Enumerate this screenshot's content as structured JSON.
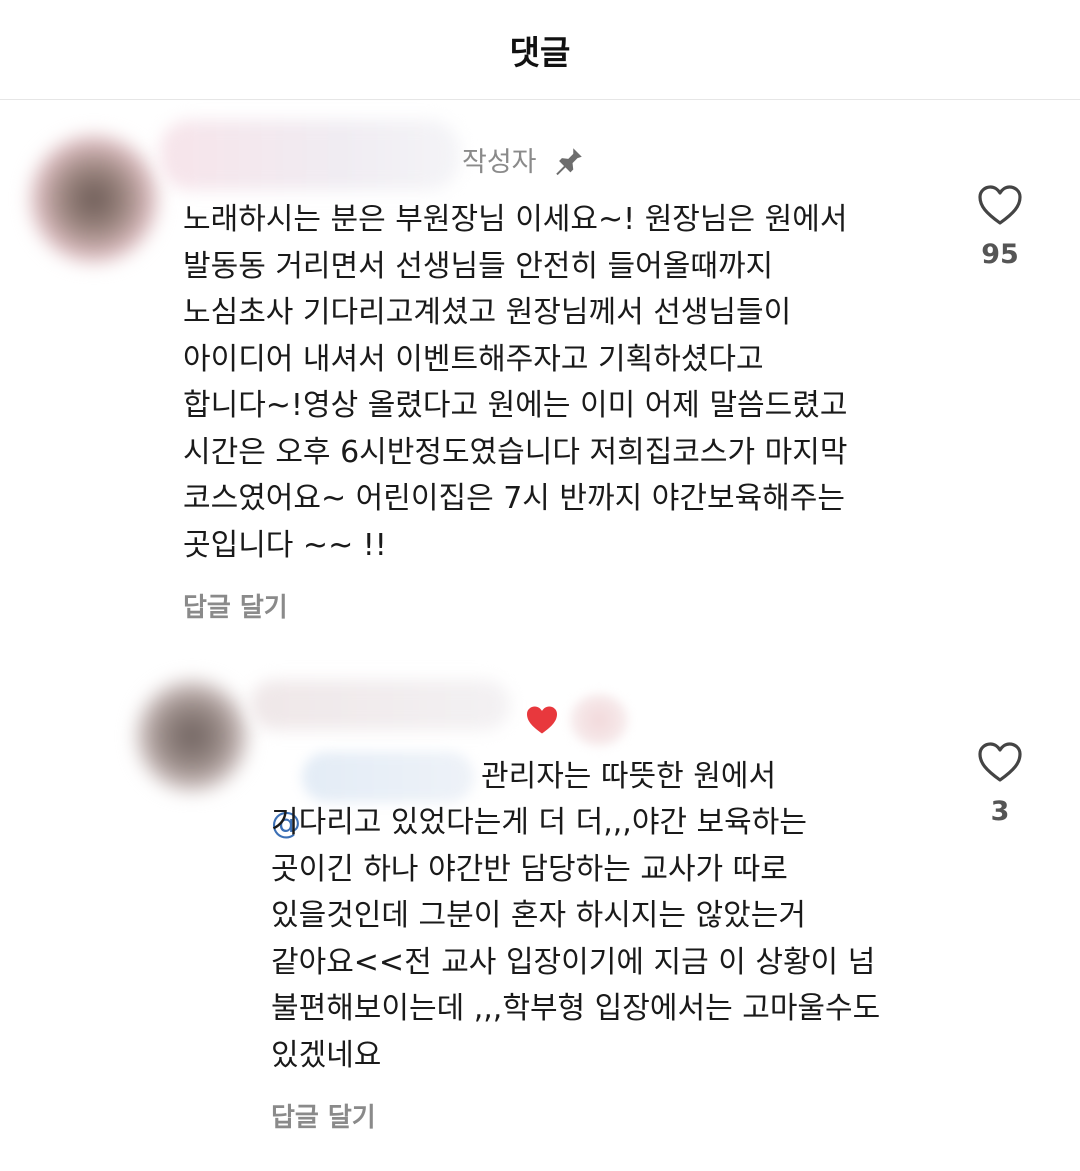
{
  "header": {
    "title": "댓글"
  },
  "comments": [
    {
      "author_tag": "작성자",
      "text": "노래하시는 분은 부원장님 이세요~! 원장님은 원에서\n발동동 거리면서 선생님들 안전히 들어올때까지\n노심초사 기다리고계셨고 원장님께서 선생님들이\n아이디어 내셔서 이벤트해주자고 기획하셨다고\n합니다~!영상 올렸다고 원에는 이미 어제 말씀드렸고\n시간은 오후 6시반정도였습니다 저희집코스가 마지막\n코스였어요~  어린이집은 7시 반까지 야간보육해주는\n곳입니다 ~~ !!",
      "reply_label": "답글 달기",
      "likes": "95"
    },
    {
      "mention_prefix": "@",
      "text_first": "관리자는 따뜻한 원에서",
      "text_rest": "기다리고 있었다는게 더 더,,,야간 보육하는\n곳이긴 하나 야간반 담당하는 교사가 따로\n있을것인데 그분이 혼자 하시지는 않았는거\n같아요<<전 교사 입장이기에 지금 이 상황이 넘\n불편해보이는데 ,,,학부형 입장에서는 고마울수도\n있겠네요",
      "reply_label": "답글 달기",
      "likes": "3"
    }
  ],
  "colors": {
    "heart_red": "#e8383d",
    "muted": "#8a8a8a",
    "mention": "#3b6fb5"
  }
}
